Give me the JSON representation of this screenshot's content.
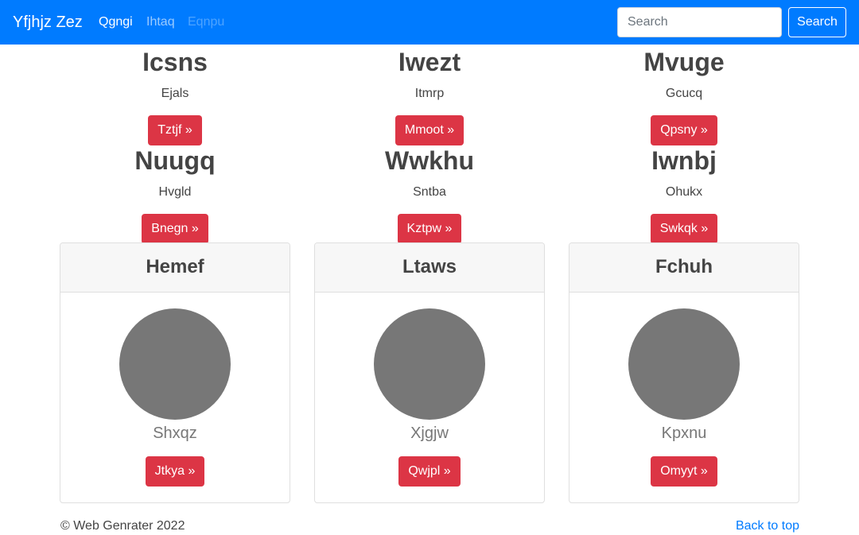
{
  "navbar": {
    "brand": "Yfjhjz Zez",
    "links": [
      "Qgngi",
      "Ihtaq",
      "Eqnpu"
    ],
    "search_placeholder": "Search",
    "search_button": "Search",
    "background_color": "#007bff"
  },
  "features": [
    {
      "title": "Icsns",
      "subtitle": "Ejals",
      "button": "Tztjf »"
    },
    {
      "title": "Iwezt",
      "subtitle": "Itmrp",
      "button": "Mmoot »"
    },
    {
      "title": "Mvuge",
      "subtitle": "Gcucq",
      "button": "Qpsny »"
    },
    {
      "title": "Nuugq",
      "subtitle": "Hvgld",
      "button": "Bnegn »"
    },
    {
      "title": "Wwkhu",
      "subtitle": "Sntba",
      "button": "Kztpw »"
    },
    {
      "title": "Iwnbj",
      "subtitle": "Ohukx",
      "button": "Swkqk »"
    }
  ],
  "cards": [
    {
      "header": "Hemef",
      "subtitle": "Shxqz",
      "button": "Jtkya »"
    },
    {
      "header": "Ltaws",
      "subtitle": "Xjgjw",
      "button": "Qwjpl »"
    },
    {
      "header": "Fchuh",
      "subtitle": "Kpxnu",
      "button": "Omyyt »"
    }
  ],
  "footer": {
    "copyright": "© Web Genrater 2022",
    "back_to_top": "Back to top"
  },
  "colors": {
    "button_red": "#dc3545",
    "avatar_gray": "#777777"
  }
}
